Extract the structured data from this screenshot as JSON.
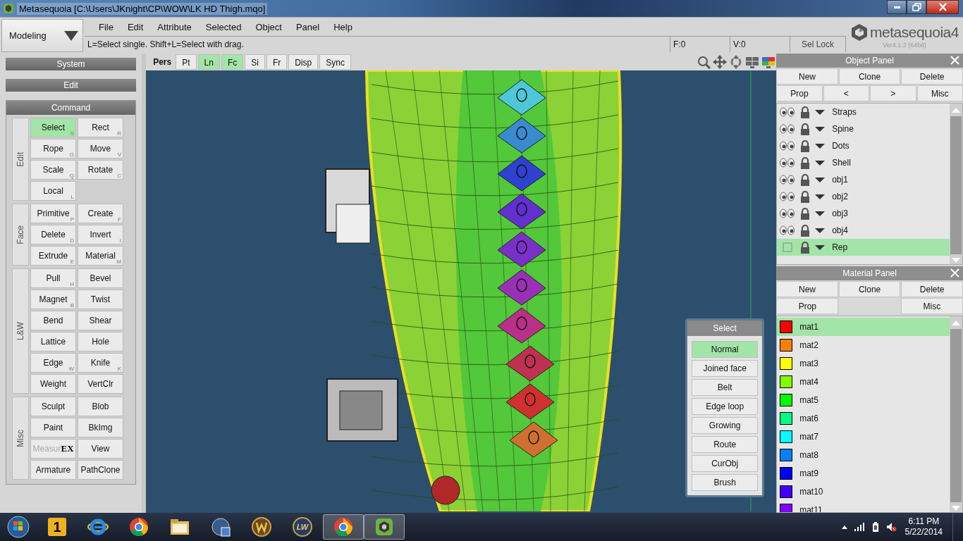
{
  "window": {
    "title": "Metasequoia [C:\\Users\\JKnight\\CP\\WOW\\LK HD Thigh.mqo]"
  },
  "mode": {
    "label": "Modeling"
  },
  "menu": [
    "File",
    "Edit",
    "Attribute",
    "Selected",
    "Object",
    "Panel",
    "Help"
  ],
  "hint": "L=Select single.  Shift+L=Select with drag.",
  "counters": [
    "F:0",
    "V:0"
  ],
  "sel_lock": {
    "label": "Sel Lock"
  },
  "logo": {
    "name": "metasequoia4",
    "version": "Ver4.1.2 (64bit)"
  },
  "left_panel": {
    "headers": [
      "System",
      "Edit"
    ],
    "command_title": "Command",
    "groups": [
      {
        "label": "Edit",
        "buttons": [
          {
            "label": "Select",
            "key": "S",
            "selected": true,
            "disabled": false
          },
          {
            "label": "Rect",
            "key": "R",
            "selected": false,
            "disabled": false
          },
          {
            "label": "Rope",
            "key": "G",
            "selected": false,
            "disabled": false
          },
          {
            "label": "Move",
            "key": "V",
            "selected": false,
            "disabled": false
          },
          {
            "label": "Scale",
            "key": "Q",
            "selected": false,
            "disabled": false
          },
          {
            "label": "Rotate",
            "key": "C",
            "selected": false,
            "disabled": false
          },
          {
            "label": "Local",
            "key": "L",
            "selected": false,
            "disabled": false
          }
        ]
      },
      {
        "label": "Face",
        "buttons": [
          {
            "label": "Primitive",
            "key": "P",
            "selected": false,
            "disabled": false
          },
          {
            "label": "Create",
            "key": "F",
            "selected": false,
            "disabled": false
          },
          {
            "label": "Delete",
            "key": "D",
            "selected": false,
            "disabled": false
          },
          {
            "label": "Invert",
            "key": "I",
            "selected": false,
            "disabled": false
          },
          {
            "label": "Extrude",
            "key": "E",
            "selected": false,
            "disabled": false
          },
          {
            "label": "Material",
            "key": "M",
            "selected": false,
            "disabled": false
          }
        ]
      },
      {
        "label": "L&W",
        "buttons": [
          {
            "label": "Pull",
            "key": "H",
            "selected": false,
            "disabled": false
          },
          {
            "label": "Bevel",
            "selected": false,
            "disabled": false
          },
          {
            "label": "Magnet",
            "key": "B",
            "selected": false,
            "disabled": false
          },
          {
            "label": "Twist",
            "selected": false,
            "disabled": false
          },
          {
            "label": "Bend",
            "selected": false,
            "disabled": false
          },
          {
            "label": "Shear",
            "selected": false,
            "disabled": false
          },
          {
            "label": "Lattice",
            "selected": false,
            "disabled": false
          },
          {
            "label": "Hole",
            "selected": false,
            "disabled": false
          },
          {
            "label": "Edge",
            "key": "W",
            "selected": false,
            "disabled": false
          },
          {
            "label": "Knife",
            "key": "K",
            "selected": false,
            "disabled": false
          },
          {
            "label": "Weight",
            "selected": false,
            "disabled": false
          },
          {
            "label": "VertClr",
            "selected": false,
            "disabled": false
          }
        ]
      },
      {
        "label": "Misc",
        "buttons": [
          {
            "label": "Sculpt",
            "selected": false,
            "disabled": false
          },
          {
            "label": "Blob",
            "selected": false,
            "disabled": false
          },
          {
            "label": "Paint",
            "selected": false,
            "disabled": false
          },
          {
            "label": "BkImg",
            "selected": false,
            "disabled": false
          },
          {
            "label": "Measur",
            "badge": "EX",
            "selected": false,
            "disabled": true
          },
          {
            "label": "View",
            "selected": false,
            "disabled": false
          },
          {
            "label": "Armature",
            "selected": false,
            "disabled": false
          },
          {
            "label": "PathClone",
            "selected": false,
            "disabled": false
          }
        ]
      }
    ]
  },
  "viewport": {
    "view_label": "Pers",
    "toggles": [
      {
        "label": "Pt",
        "on": false
      },
      {
        "label": "Ln",
        "on": true
      },
      {
        "label": "Fc",
        "on": true
      },
      {
        "label": "Si",
        "on": false
      },
      {
        "label": "Fr",
        "on": false
      },
      {
        "label": "Disp",
        "on": false
      },
      {
        "label": "Sync",
        "on": false
      }
    ]
  },
  "select_popup": {
    "title": "Select",
    "options": [
      {
        "label": "Normal",
        "selected": true
      },
      {
        "label": "Joined face",
        "selected": false
      },
      {
        "label": "Belt",
        "selected": false
      },
      {
        "label": "Edge loop",
        "selected": false
      },
      {
        "label": "Growing",
        "selected": false
      },
      {
        "label": "Route",
        "selected": false
      },
      {
        "label": "CurObj",
        "selected": false
      },
      {
        "label": "Brush",
        "selected": false
      }
    ]
  },
  "object_panel": {
    "title": "Object Panel",
    "button_rows": [
      [
        {
          "kind": "button",
          "label": "New"
        },
        {
          "kind": "button",
          "label": "Clone"
        },
        {
          "kind": "button",
          "label": "Delete"
        }
      ],
      [
        {
          "kind": "button",
          "label": "Prop"
        },
        {
          "kind": "button",
          "label": "<"
        },
        {
          "kind": "button",
          "label": ">"
        },
        {
          "kind": "button",
          "label": "Misc"
        }
      ]
    ],
    "objects": [
      {
        "name": "Straps",
        "visible": true,
        "selected": false
      },
      {
        "name": "Spine",
        "visible": true,
        "selected": false
      },
      {
        "name": "Dots",
        "visible": true,
        "selected": false
      },
      {
        "name": "Shell",
        "visible": true,
        "selected": false
      },
      {
        "name": "obj1",
        "visible": true,
        "selected": false
      },
      {
        "name": "obj2",
        "visible": true,
        "selected": false
      },
      {
        "name": "obj3",
        "visible": true,
        "selected": false
      },
      {
        "name": "obj4",
        "visible": true,
        "selected": false
      },
      {
        "name": "Rep",
        "visible": false,
        "selected": true
      }
    ]
  },
  "material_panel": {
    "title": "Material Panel",
    "button_rows": [
      [
        {
          "kind": "button",
          "label": "New"
        },
        {
          "kind": "button",
          "label": "Clone"
        },
        {
          "kind": "button",
          "label": "Delete"
        }
      ],
      [
        {
          "kind": "button",
          "label": "Prop"
        },
        {
          "kind": "blank"
        },
        {
          "kind": "button",
          "label": "Misc"
        }
      ]
    ],
    "materials": [
      {
        "name": "mat1",
        "color": "#ff0000",
        "selected": true
      },
      {
        "name": "mat2",
        "color": "#ff7f00",
        "selected": false
      },
      {
        "name": "mat3",
        "color": "#ffff00",
        "selected": false
      },
      {
        "name": "mat4",
        "color": "#80ff00",
        "selected": false
      },
      {
        "name": "mat5",
        "color": "#00ff00",
        "selected": false
      },
      {
        "name": "mat6",
        "color": "#00ff80",
        "selected": false
      },
      {
        "name": "mat7",
        "color": "#00ffff",
        "selected": false
      },
      {
        "name": "mat8",
        "color": "#0080ff",
        "selected": false
      },
      {
        "name": "mat9",
        "color": "#0000ff",
        "selected": false
      },
      {
        "name": "mat10",
        "color": "#4000ff",
        "selected": false
      },
      {
        "name": "mat11",
        "color": "#8000ff",
        "selected": false
      }
    ]
  },
  "taskbar": {
    "apps": [
      {
        "kind": "badge",
        "label": "1",
        "active": false
      },
      {
        "kind": "ie",
        "active": false
      },
      {
        "kind": "chrome",
        "active": false
      },
      {
        "kind": "folder",
        "active": false
      },
      {
        "kind": "hp",
        "active": false
      },
      {
        "kind": "w",
        "active": false
      },
      {
        "kind": "badge-round",
        "label": "LW",
        "active": false
      },
      {
        "kind": "chrome",
        "active": true
      },
      {
        "kind": "meta",
        "active": true
      }
    ],
    "time": "6:11 PM",
    "date": "5/22/2014"
  }
}
